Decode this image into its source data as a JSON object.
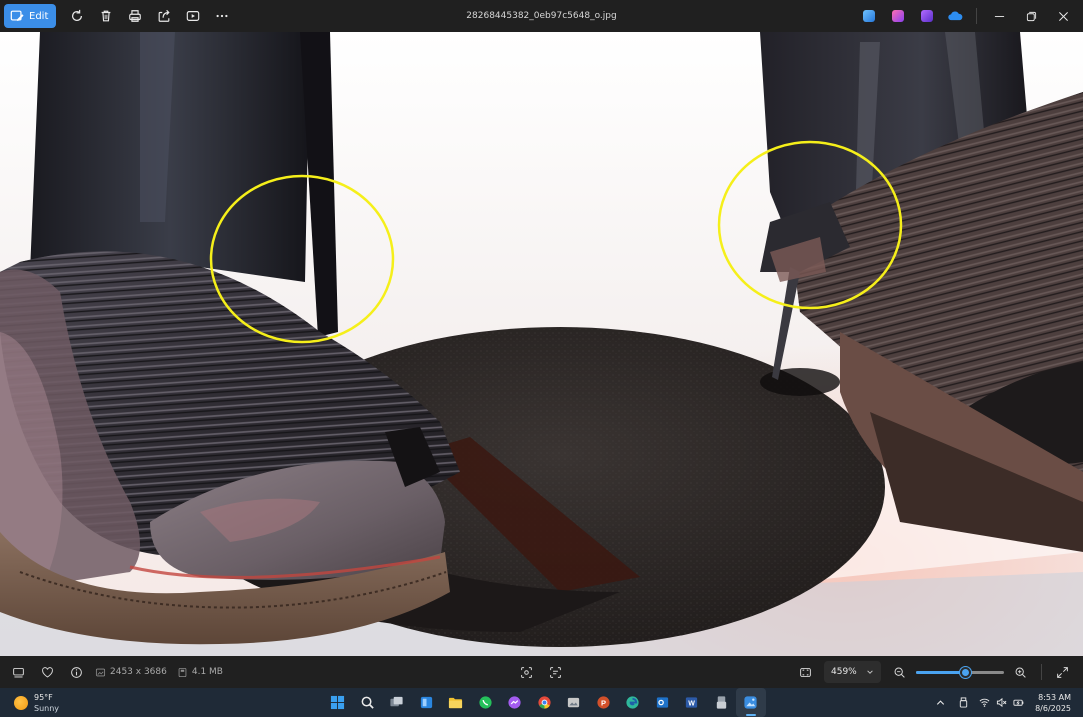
{
  "window": {
    "filename": "28268445382_0eb97c5648_o.jpg",
    "edit_label": "Edit"
  },
  "toolbar_icons": [
    "rotate-icon",
    "delete-icon",
    "print-icon",
    "share-icon",
    "slideshow-icon",
    "more-icon"
  ],
  "title_apps": [
    {
      "name": "photos-app",
      "color": "#3a8de0"
    },
    {
      "name": "designer-app",
      "color": "#d9469b"
    },
    {
      "name": "clipchamp-app",
      "color": "#7f4ad6"
    },
    {
      "name": "onedrive-app",
      "color": "#1f7fe0"
    }
  ],
  "photo": {
    "annotations": [
      {
        "label": "left-annotation-circle",
        "color": "#f5ef1a"
      },
      {
        "label": "right-annotation-circle",
        "color": "#f5ef1a"
      }
    ]
  },
  "status": {
    "dimensions": "2453 x 3686",
    "file_size": "4.1 MB",
    "zoom": "459%",
    "zoom_slider_fraction": 0.56
  },
  "taskbar": {
    "weather_temp": "95°F",
    "weather_desc": "Sunny",
    "time": "8:53 AM",
    "date": "8/6/2025",
    "apps": [
      {
        "name": "start",
        "color": "#3aa0f0"
      },
      {
        "name": "search",
        "color": "#2b3744"
      },
      {
        "name": "task-view",
        "color": "#7c8794"
      },
      {
        "name": "widgets",
        "color": "#2a86e0"
      },
      {
        "name": "file-explorer",
        "color": "#f2c230"
      },
      {
        "name": "whatsapp",
        "color": "#25c05b"
      },
      {
        "name": "messenger",
        "color": "#a35cf0"
      },
      {
        "name": "chrome",
        "color": "#e5493a"
      },
      {
        "name": "photo-viewer",
        "color": "#c8c8c8"
      },
      {
        "name": "powerpoint",
        "color": "#d2502a"
      },
      {
        "name": "edge",
        "color": "#2fb89b"
      },
      {
        "name": "outlook",
        "color": "#1e72c9"
      },
      {
        "name": "word",
        "color": "#2c5aa8"
      },
      {
        "name": "usb-device",
        "color": "#9aa3ad"
      },
      {
        "name": "photos",
        "color": "#3a8de0"
      }
    ]
  },
  "colors": {
    "accent": "#3b8ee8",
    "annotation": "#f5ef1a",
    "chrome_bg": "#202020",
    "taskbar_bg": "#1f2a37"
  }
}
